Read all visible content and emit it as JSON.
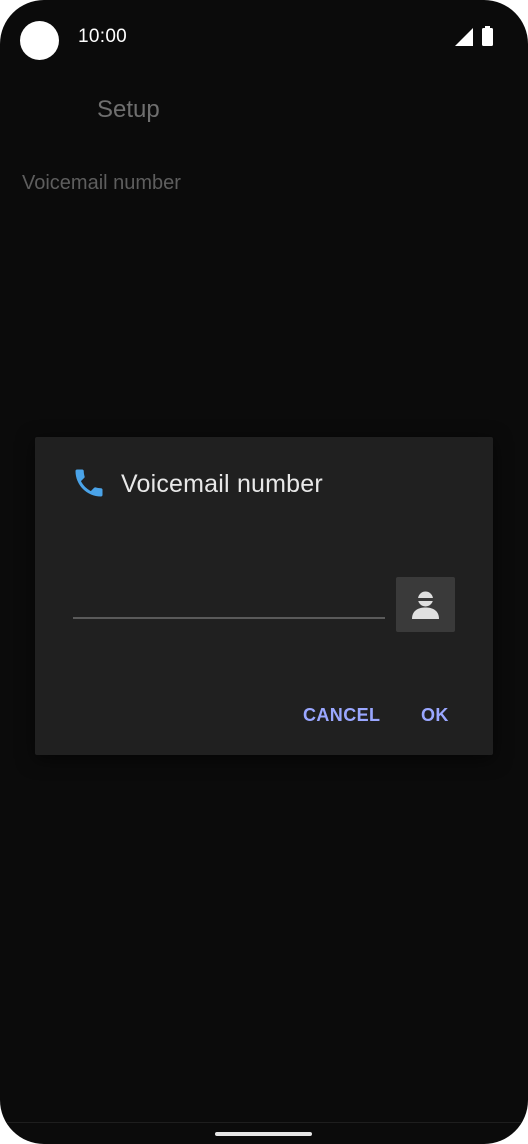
{
  "status_bar": {
    "time": "10:00"
  },
  "screen": {
    "title": "Setup",
    "preference_item": "Voicemail number"
  },
  "dialog": {
    "title": "Voicemail number",
    "number_value": "",
    "cancel_label": "CANCEL",
    "ok_label": "OK",
    "icons": {
      "title_icon": "phone-icon",
      "contact_icon": "contact-icon"
    }
  },
  "colors": {
    "background": "#0b0b0b",
    "dialog": "#202020",
    "accent_button_text": "#9aa7ff",
    "phone_icon": "#4aa3e8"
  }
}
